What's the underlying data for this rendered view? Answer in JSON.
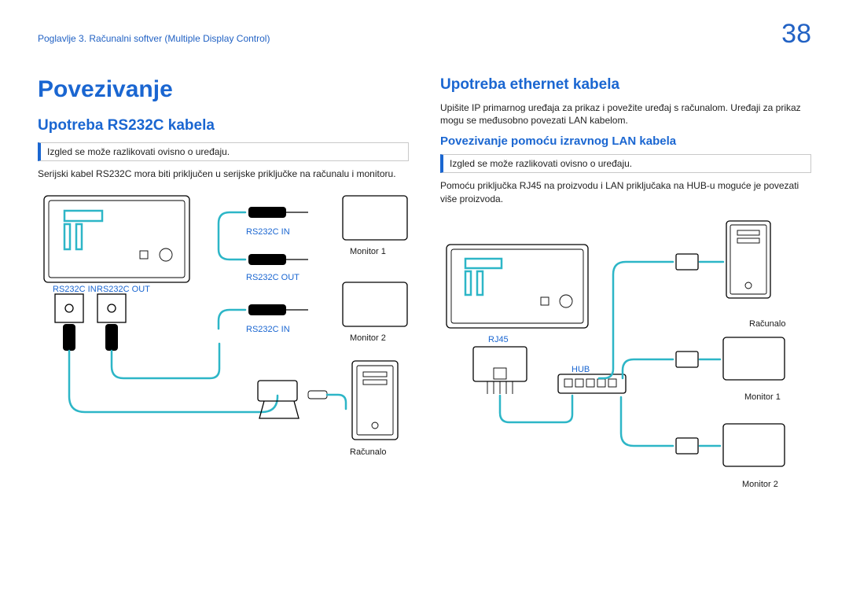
{
  "header": {
    "chapter": "Poglavlje 3. Računalni softver (Multiple Display Control)",
    "page_number": "38"
  },
  "left": {
    "h1": "Povezivanje",
    "h2": "Upotreba RS232C kabela",
    "note": "Izgled se može razlikovati ovisno o uređaju.",
    "p1": "Serijski kabel RS232C mora biti priključen u serijske priključke na računalu i monitoru.",
    "labels": {
      "rs232c_in": "RS232C IN",
      "rs232c_out": "RS232C OUT",
      "monitor1": "Monitor 1",
      "monitor2": "Monitor 2",
      "computer": "Računalo"
    }
  },
  "right": {
    "h2": "Upotreba ethernet kabela",
    "p_intro": "Upišite IP primarnog uređaja za prikaz i povežite uređaj s računalom. Uređaji za prikaz mogu se međusobno povezati LAN kabelom.",
    "h3": "Povezivanje pomoću izravnog LAN kabela",
    "note": "Izgled se može razlikovati ovisno o uređaju.",
    "p1": "Pomoću priključka RJ45 na proizvodu i LAN priključaka na HUB-u moguće je povezati više proizvoda.",
    "labels": {
      "rj45": "RJ45",
      "hub": "HUB",
      "computer": "Računalo",
      "monitor1": "Monitor 1",
      "monitor2": "Monitor 2"
    }
  }
}
